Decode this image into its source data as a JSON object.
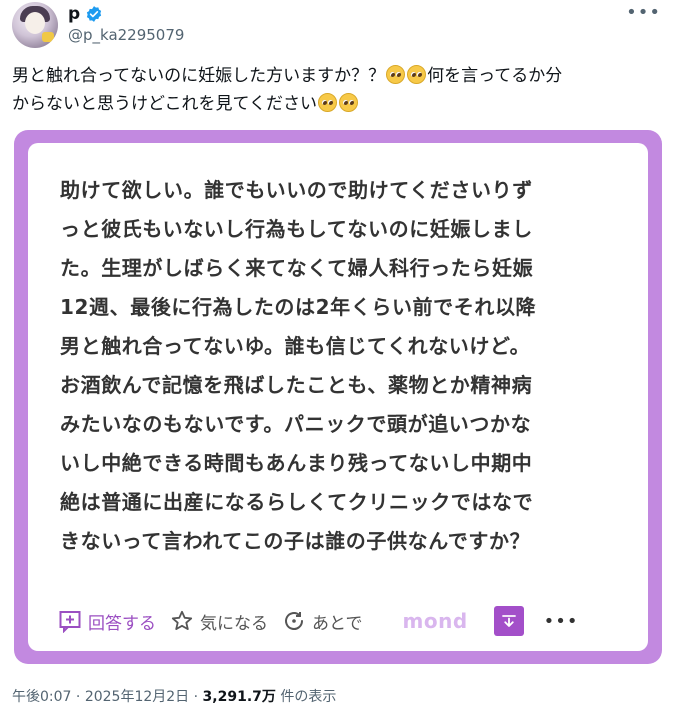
{
  "author": {
    "display_name": "p",
    "handle": "@p_ka2295079",
    "verified_badge_color": "#1d9bf0"
  },
  "tweet": {
    "text_line1": "男と触れ合ってないのに妊娠した方いますか？？",
    "text_line1_after": "何を言ってるか分",
    "text_line2": "からないと思うけどこれを見てください",
    "emoji_name": "pleading-face-emoji"
  },
  "card": {
    "border_color": "#c289e0",
    "lines": [
      "助けて欲しい。誰でもいいので助けてくださいりず",
      "っと彼氏もいないし行為もしてないのに妊娠しまし",
      "た。生理がしばらく来てなくて婦人科行ったら妊娠",
      "12週、最後に行為したのは2年くらい前でそれ以降",
      "男と触れ合ってないゆ。誰も信じてくれないけど。",
      "お酒飲んで記憶を飛ばしたことも、薬物とか精神病",
      "みたいなのもないです。パニックで頭が追いつかな",
      "いし中絶できる時間もあんまり残ってないし中期中",
      "絶は普通に出産になるらしくてクリニックではなで",
      "きないって言われてこの子は誰の子供なんですか？"
    ],
    "actions": {
      "answer_label": "回答する",
      "favorite_label": "気になる",
      "later_label": "あとで"
    },
    "brand": "mond",
    "accent_color": "#a34fc9"
  },
  "meta": {
    "time": "午後0:07",
    "separator": " · ",
    "date": "2025年12月2日",
    "views_count": "3,291.7万",
    "views_label": " 件の表示"
  }
}
